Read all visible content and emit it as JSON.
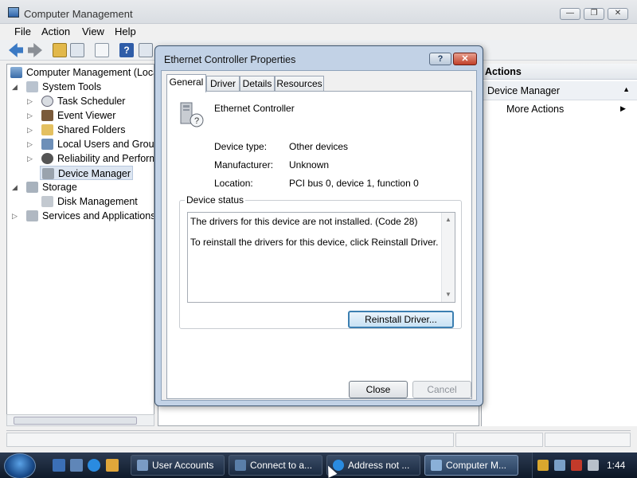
{
  "window": {
    "title": "Computer Management",
    "minimize": "—",
    "maximize": "❐",
    "close": "✕"
  },
  "menu": [
    "File",
    "Action",
    "View",
    "Help"
  ],
  "tree": {
    "root": "Computer Management (Local)",
    "system_tools": "System Tools",
    "task_scheduler": "Task Scheduler",
    "event_viewer": "Event Viewer",
    "shared_folders": "Shared Folders",
    "local_users": "Local Users and Groups",
    "reliability": "Reliability and Performance",
    "device_manager": "Device Manager",
    "storage": "Storage",
    "disk_management": "Disk Management",
    "services": "Services and Applications"
  },
  "actions": {
    "header": "Actions",
    "section": "Device Manager",
    "more": "More Actions"
  },
  "dialog": {
    "title": "Ethernet Controller Properties",
    "help": "?",
    "close": "✕",
    "tabs": [
      "General",
      "Driver",
      "Details",
      "Resources"
    ],
    "device_name": "Ethernet Controller",
    "props": {
      "type_label": "Device type:",
      "type_value": "Other devices",
      "mfr_label": "Manufacturer:",
      "mfr_value": "Unknown",
      "loc_label": "Location:",
      "loc_value": "PCI bus 0, device 1, function 0"
    },
    "status": {
      "legend": "Device status",
      "line1": "The drivers for this device are not installed. (Code 28)",
      "line2": "To reinstall the drivers for this device, click Reinstall Driver."
    },
    "reinstall_button": "Reinstall Driver...",
    "close_button": "Close",
    "cancel_button": "Cancel"
  },
  "taskbar": {
    "tasks": [
      "User Accounts",
      "Connect to a...",
      "Address not ...",
      "Computer M..."
    ],
    "clock": "1:44"
  },
  "colors": {
    "dialog_frame": "#c2d2e6",
    "close_red": "#c1402a",
    "taskbar": "#1b2b42",
    "selection": "#dde6f2"
  }
}
